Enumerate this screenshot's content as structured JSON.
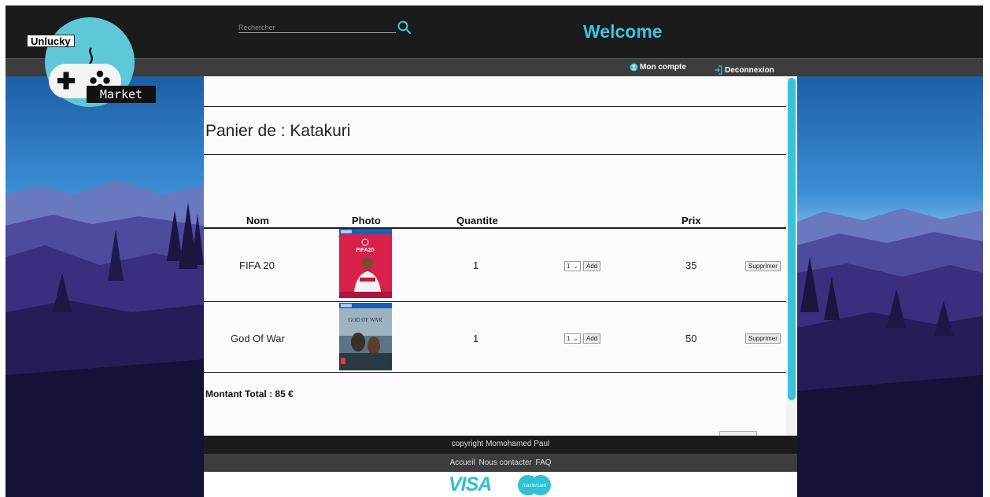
{
  "header": {
    "search_placeholder": "Rechercher",
    "welcome": "Welcome",
    "account_label": "Mon compte",
    "logout_label": "Deconnexion"
  },
  "logo": {
    "top_word": "Unlucky",
    "bottom_word": "Market"
  },
  "cart": {
    "title": "Panier de : Katakuri",
    "columns": {
      "name": "Nom",
      "photo": "Photo",
      "quantity": "Quantite",
      "price": "Prix"
    },
    "rows": [
      {
        "name": "FIFA 20",
        "photo": "fifa-20-cover",
        "quantity": "1",
        "select_value": "1",
        "add_label": "Add",
        "price": "35",
        "delete_label": "Supprimer"
      },
      {
        "name": "God Of War",
        "photo": "god-of-war-cover",
        "quantity": "1",
        "select_value": "1",
        "add_label": "Add",
        "price": "50",
        "delete_label": "Supprimer"
      }
    ],
    "total": "Montant Total : 85 €"
  },
  "footer": {
    "copyright": "copyright Momohamed Paul",
    "links": [
      "Accueil",
      "Nous contacter",
      "FAQ"
    ],
    "payment": {
      "visa": "VISA",
      "mastercard": "mastercard"
    }
  },
  "colors": {
    "accent": "#3fc4dc",
    "header_bg": "#1b1b1b",
    "subbar_bg": "#3d3d3d"
  }
}
